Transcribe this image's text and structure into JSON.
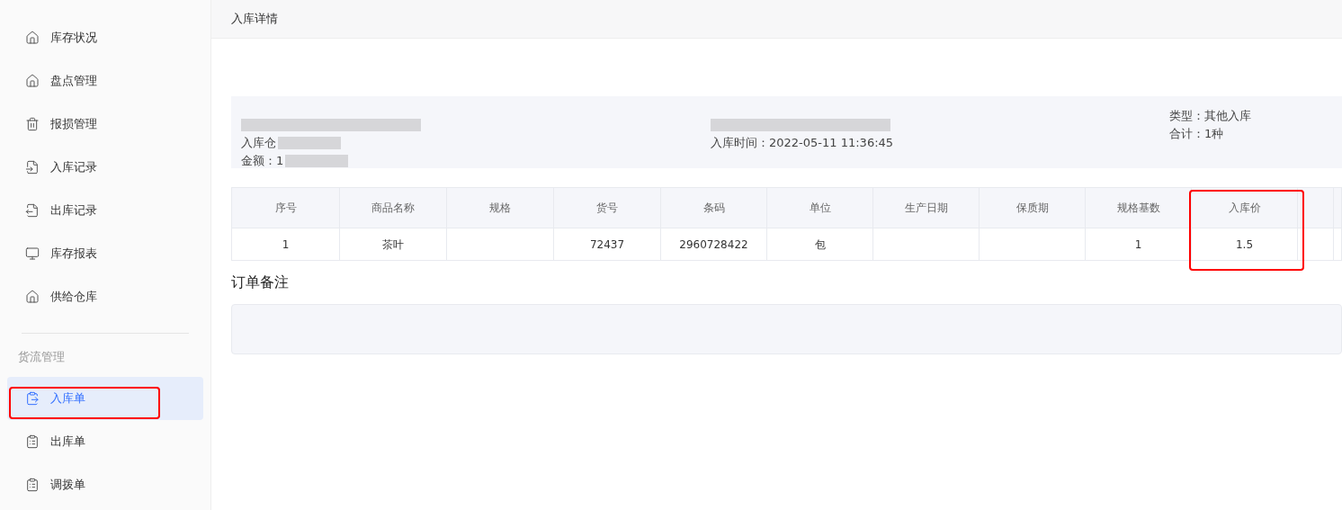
{
  "sidebar": {
    "sections": [
      {
        "items": [
          {
            "label": "库存状况",
            "selected": false,
            "highlighted": false
          },
          {
            "label": "盘点管理",
            "selected": false,
            "highlighted": false
          },
          {
            "label": "报损管理",
            "selected": false,
            "highlighted": false
          },
          {
            "label": "入库记录",
            "selected": false,
            "highlighted": false
          },
          {
            "label": "出库记录",
            "selected": false,
            "highlighted": false
          },
          {
            "label": "库存报表",
            "selected": false,
            "highlighted": false
          },
          {
            "label": "供给仓库",
            "selected": false,
            "highlighted": false
          }
        ]
      },
      {
        "title": "货流管理",
        "items": [
          {
            "label": "入库单",
            "selected": true,
            "highlighted": true
          },
          {
            "label": "出库单",
            "selected": false,
            "highlighted": false
          },
          {
            "label": "调拨单",
            "selected": false,
            "highlighted": false
          }
        ]
      }
    ]
  },
  "header": {
    "title": "入库详情"
  },
  "info": {
    "columns": [
      [
        {
          "blurred": true
        },
        {
          "text": "入库仓",
          "blurred": true
        },
        {
          "text": "金额：1",
          "blurred": true
        }
      ],
      [
        {
          "blurred": true
        },
        {
          "text": "入库时间：2022-05-11 11:36:45",
          "blurred": false
        }
      ],
      [
        {
          "text": "类型：其他入库",
          "blurred": false
        },
        {
          "text": "合计：1种",
          "blurred": false
        }
      ]
    ]
  },
  "table": {
    "columns": [
      {
        "label": "序号",
        "highlighted": false
      },
      {
        "label": "商品名称",
        "highlighted": false
      },
      {
        "label": "规格",
        "highlighted": false
      },
      {
        "label": "货号",
        "highlighted": false
      },
      {
        "label": "条码",
        "highlighted": false
      },
      {
        "label": "单位",
        "highlighted": false
      },
      {
        "label": "生产日期",
        "highlighted": false
      },
      {
        "label": "保质期",
        "highlighted": false
      },
      {
        "label": "规格基数",
        "highlighted": false
      },
      {
        "label": "入库价",
        "highlighted": true
      },
      {
        "highlighted": false
      }
    ],
    "rows": [
      [
        "1",
        "茶叶",
        "",
        "72437",
        "2960728422",
        "包",
        "",
        "",
        "1",
        "1.5",
        ""
      ]
    ]
  },
  "remarks": {
    "title": "订单备注"
  }
}
